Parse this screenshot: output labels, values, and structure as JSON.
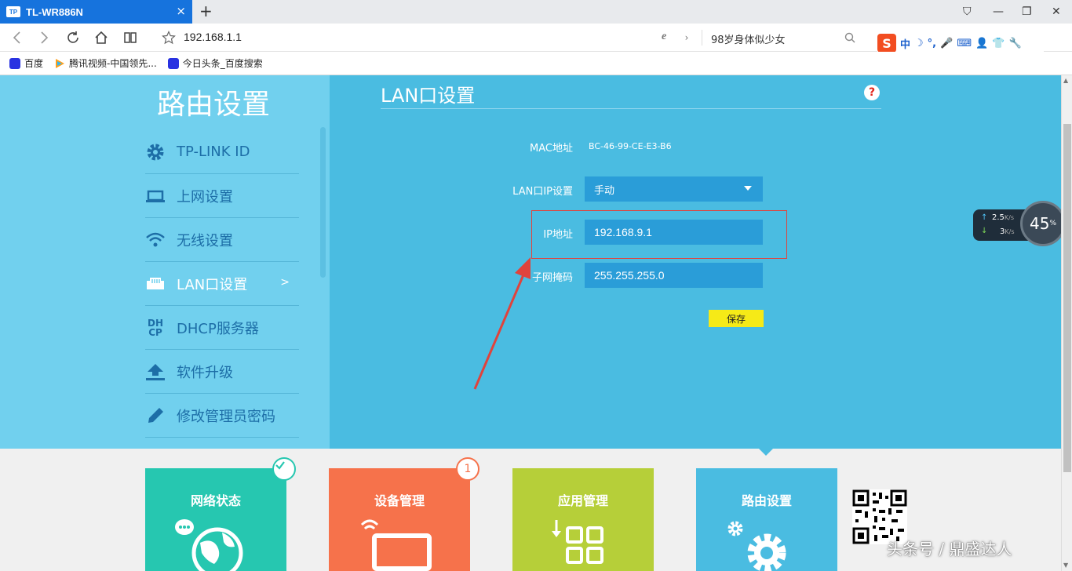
{
  "browser": {
    "tab_title": "TL-WR886N",
    "tab_logo": "TP",
    "address": "192.168.1.1",
    "search_text": "98岁身体似少女",
    "new_tab": "+",
    "close_tab": "×",
    "window": {
      "minimize": "—",
      "restore": "❐",
      "close": "✕",
      "pin": "⛉"
    },
    "sogou": {
      "logo": "S",
      "items": [
        "中",
        "☽",
        "°,",
        "🎤",
        "⌨",
        "👤",
        "👕",
        "🔧"
      ]
    },
    "bookmarks": [
      {
        "label": "百度",
        "icon": "baidu-paw-icon",
        "color": "#2932e1"
      },
      {
        "label": "腾讯视频-中国领先...",
        "icon": "tencent-video-icon",
        "color": "#ff9f1a"
      },
      {
        "label": "今日头条_百度搜索",
        "icon": "baidu-paw-icon",
        "color": "#2932e1"
      }
    ]
  },
  "router": {
    "page_title": "路由设置",
    "menu": [
      {
        "label": "TP-LINK ID",
        "icon": "gear-icon",
        "active": false
      },
      {
        "label": "上网设置",
        "icon": "laptop-icon",
        "active": false
      },
      {
        "label": "无线设置",
        "icon": "wifi-icon",
        "active": false
      },
      {
        "label": "LAN口设置",
        "icon": "ethernet-port-icon",
        "active": true
      },
      {
        "label": "DHCP服务器",
        "icon": "dhcp-icon",
        "active": false
      },
      {
        "label": "软件升级",
        "icon": "upload-icon",
        "active": false
      },
      {
        "label": "修改管理员密码",
        "icon": "pencil-icon",
        "active": false
      }
    ],
    "active_chevron": ">",
    "dhcp_icon_text": [
      "DH",
      "CP"
    ],
    "section_title": "LAN口设置",
    "help": "?",
    "mac_label": "MAC地址",
    "mac_value": "BC-46-99-CE-E3-B6",
    "lan_ip_setting_label": "LAN口IP设置",
    "lan_ip_setting_value": "手动",
    "ip_label": "IP地址",
    "ip_value": "192.168.9.1",
    "mask_label": "子网掩码",
    "mask_value": "255.255.255.0",
    "save_label": "保存",
    "colors": {
      "left_panel": "#71d0ee",
      "main_panel": "#4abce1",
      "field": "#2a9dd8",
      "save": "#f6ea17",
      "highlight": "#e0433c"
    }
  },
  "tiles": [
    {
      "label": "网络状态",
      "color": "#26c7b0",
      "badge": "check"
    },
    {
      "label": "设备管理",
      "color": "#f6724b",
      "badge": "1"
    },
    {
      "label": "应用管理",
      "color": "#b6cf39",
      "badge": ""
    },
    {
      "label": "路由设置",
      "color": "#4abce1",
      "badge": ""
    }
  ],
  "speed_widget": {
    "up": "2.5",
    "up_unit": "K/s",
    "down": "3",
    "down_unit": "K/s",
    "percent": "45",
    "percent_unit": "%"
  },
  "watermark": "头条号 / 鼎盛达人"
}
